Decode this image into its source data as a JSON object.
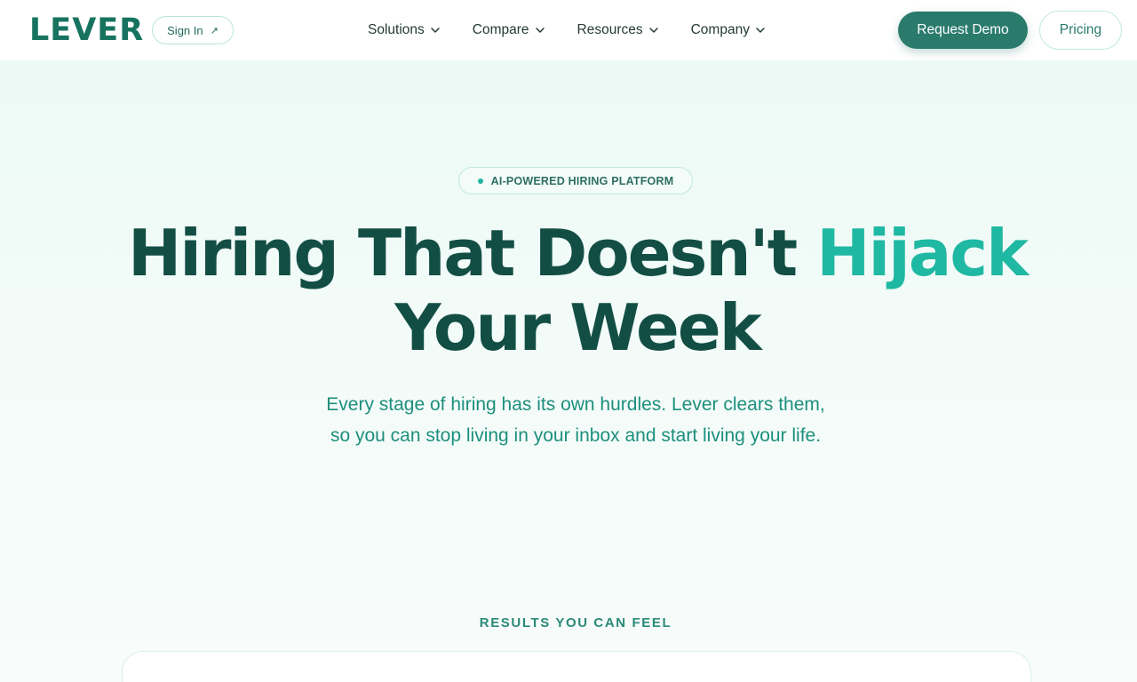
{
  "nav": {
    "logo": "LEVER",
    "signin_label": "Sign In",
    "signin_icon": "external-arrow-icon",
    "menu": [
      {
        "label": "Solutions"
      },
      {
        "label": "Compare"
      },
      {
        "label": "Resources"
      },
      {
        "label": "Company"
      }
    ],
    "demo_label": "Request Demo",
    "pricing_label": "Pricing"
  },
  "hero": {
    "badge": "AI-POWERED HIRING PLATFORM",
    "headline_part1": "Hiring That Doesn't ",
    "headline_accent": "Hijack",
    "headline_part2": "Your Week",
    "subtitle_line1": "Every stage of hiring has its own hurdles. Lever clears them,",
    "subtitle_line2": "so you can stop living in your inbox and start living your life."
  },
  "results": {
    "label": "RESULTS YOU CAN FEEL"
  },
  "colors": {
    "brand": "#17735f",
    "accent": "#1fb8a3",
    "primary_button": "#2a7b6c",
    "headline": "#134e45"
  }
}
